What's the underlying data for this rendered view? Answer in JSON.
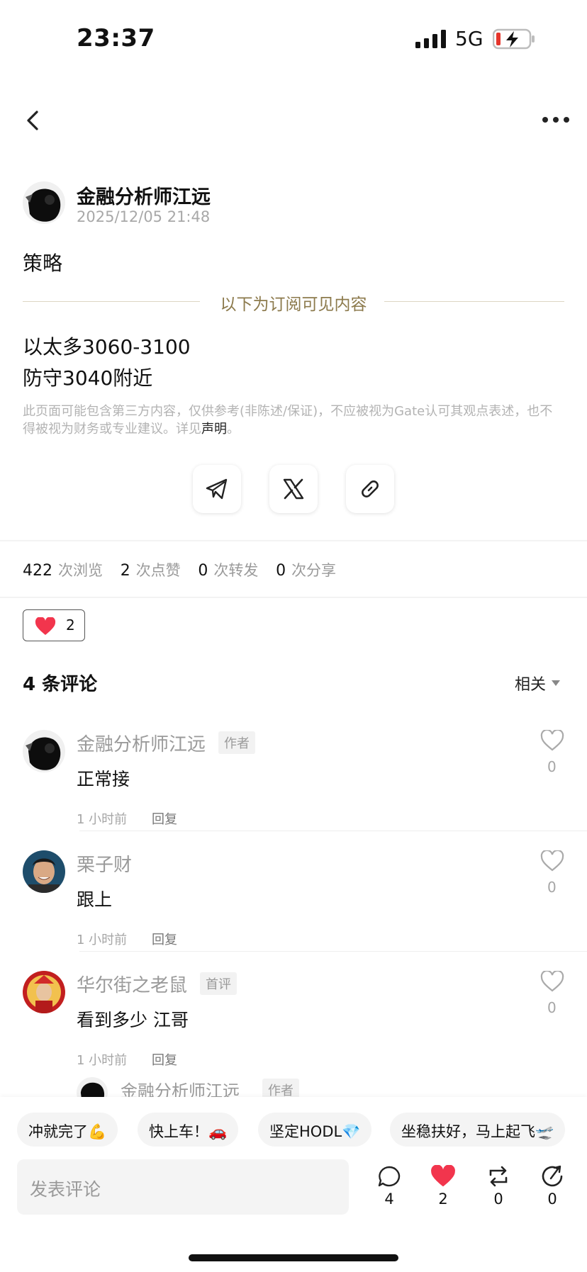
{
  "status_bar": {
    "time": "23:37",
    "network": "5G"
  },
  "post": {
    "author_name": "金融分析师江远",
    "timestamp": "2025/12/05 21:48",
    "title": "策略",
    "subscriber_divider": "以下为订阅可见内容",
    "body_lines": [
      "以太多3060-3100",
      "防守3040附近"
    ],
    "disclaimer_text": "此页面可能包含第三方内容，仅供参考(非陈述/保证)，不应被视为Gate认可其观点表述，也不得被视为财务或专业建议。详见",
    "disclaimer_link": "声明",
    "disclaimer_end": "。"
  },
  "stats": {
    "views": "422",
    "views_label": "次浏览",
    "likes": "2",
    "likes_label": "次点赞",
    "reposts": "0",
    "reposts_label": "次转发",
    "shares": "0",
    "shares_label": "次分享"
  },
  "like_chip": {
    "count": "2"
  },
  "comments": {
    "header": "4 条评论",
    "sort_label": "相关",
    "items": [
      {
        "name": "金融分析师江远",
        "badge": "作者",
        "text": "正常接",
        "time": "1 小时前",
        "reply": "回复",
        "likes": "0"
      },
      {
        "name": "栗子财",
        "badge": "",
        "text": "跟上",
        "time": "1 小时前",
        "reply": "回复",
        "likes": "0"
      },
      {
        "name": "华尔街之老鼠",
        "badge": "首评",
        "text": "看到多少 江哥",
        "time": "1 小时前",
        "reply": "回复",
        "likes": "0"
      }
    ],
    "partial_reply": {
      "name": "金融分析师江远",
      "badge": "作者"
    }
  },
  "quick_replies": [
    "冲就完了💪",
    "快上车！🚗",
    "坚定HODL💎",
    "坐稳扶好，马上起飞🛫"
  ],
  "composer": {
    "placeholder": "发表评论",
    "comment_count": "4",
    "like_count": "2",
    "repost_count": "0",
    "share_count": "0"
  },
  "colors": {
    "accent_heart": "#f2354d",
    "divider_gold": "#8c7a4c"
  }
}
